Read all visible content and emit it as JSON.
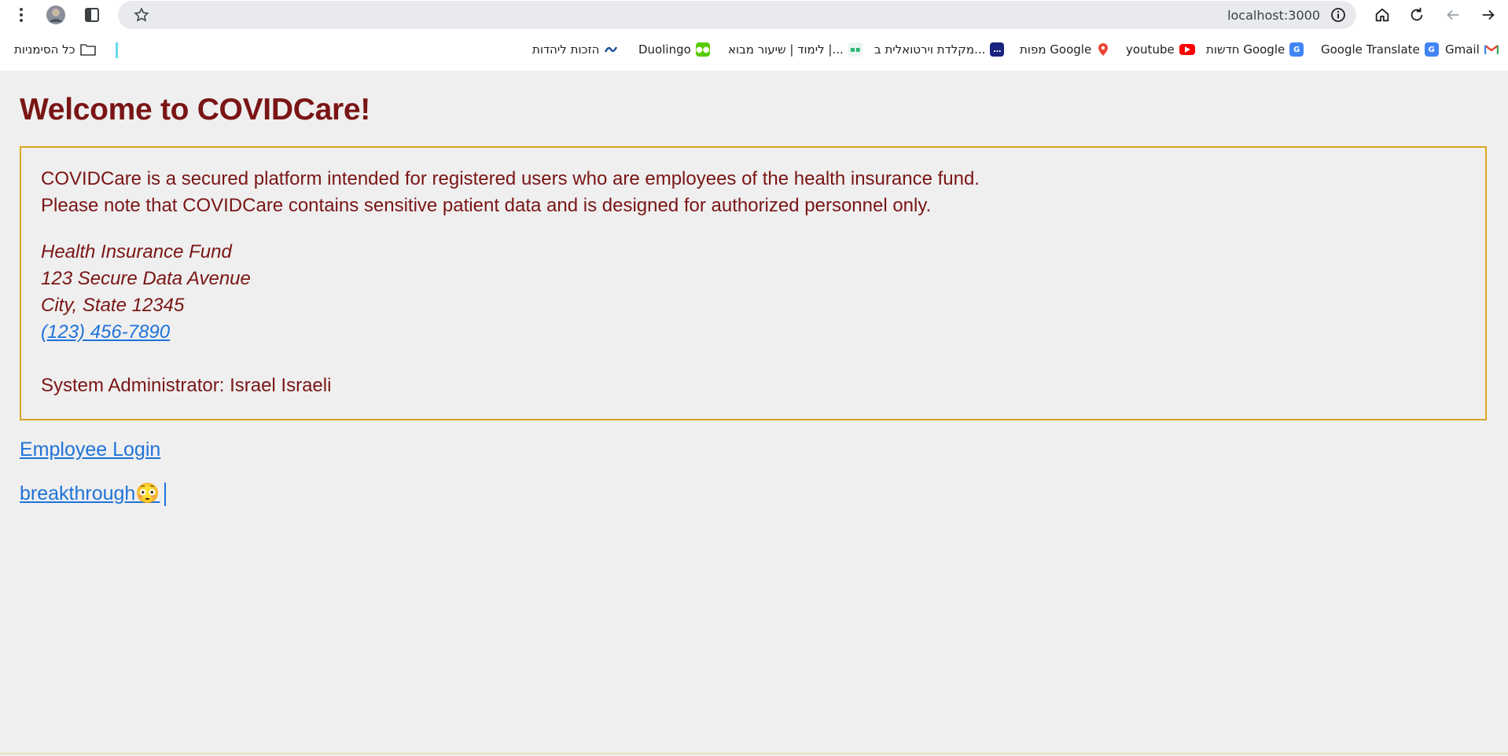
{
  "browser": {
    "url": "localhost:3000",
    "bookmarks": [
      {
        "label": "Gmail",
        "icon": "gmail-icon"
      },
      {
        "label": "Google Translate",
        "icon": "google-translate-icon"
      },
      {
        "label": "חדשות Google",
        "icon": "google-news-icon"
      },
      {
        "label": "youtube",
        "icon": "youtube-icon"
      },
      {
        "label": "מפות Google",
        "icon": "google-maps-icon"
      },
      {
        "label": "מקלדת וירטואלית ב...",
        "icon": "keyboard-chat-icon"
      },
      {
        "label": "לימוד | שיעור מבוא |...",
        "icon": "lesson-icon"
      },
      {
        "label": "Duolingo",
        "icon": "duolingo-icon"
      },
      {
        "label": "הזכות ליהדות",
        "icon": "link-icon"
      }
    ],
    "all_bookmarks_label": "כל הסימניות"
  },
  "page": {
    "title": "Welcome to COVIDCare!",
    "intro_1": "COVIDCare is a secured platform intended for registered users who are employees of the health insurance fund.",
    "intro_2": "Please note that COVIDCare contains sensitive patient data and is designed for authorized personnel only.",
    "address": {
      "org": "Health Insurance Fund",
      "street": "123 Secure Data Avenue",
      "city": "City, State 12345",
      "phone": "(123) 456-7890"
    },
    "admin": "System Administrator: Israel Israeli",
    "links": {
      "login": "Employee Login",
      "breakthrough": "breakthrough😳"
    }
  },
  "colors": {
    "heading": "#7a1515",
    "border": "#daa520",
    "link": "#1f72d9",
    "background": "#efefef"
  }
}
